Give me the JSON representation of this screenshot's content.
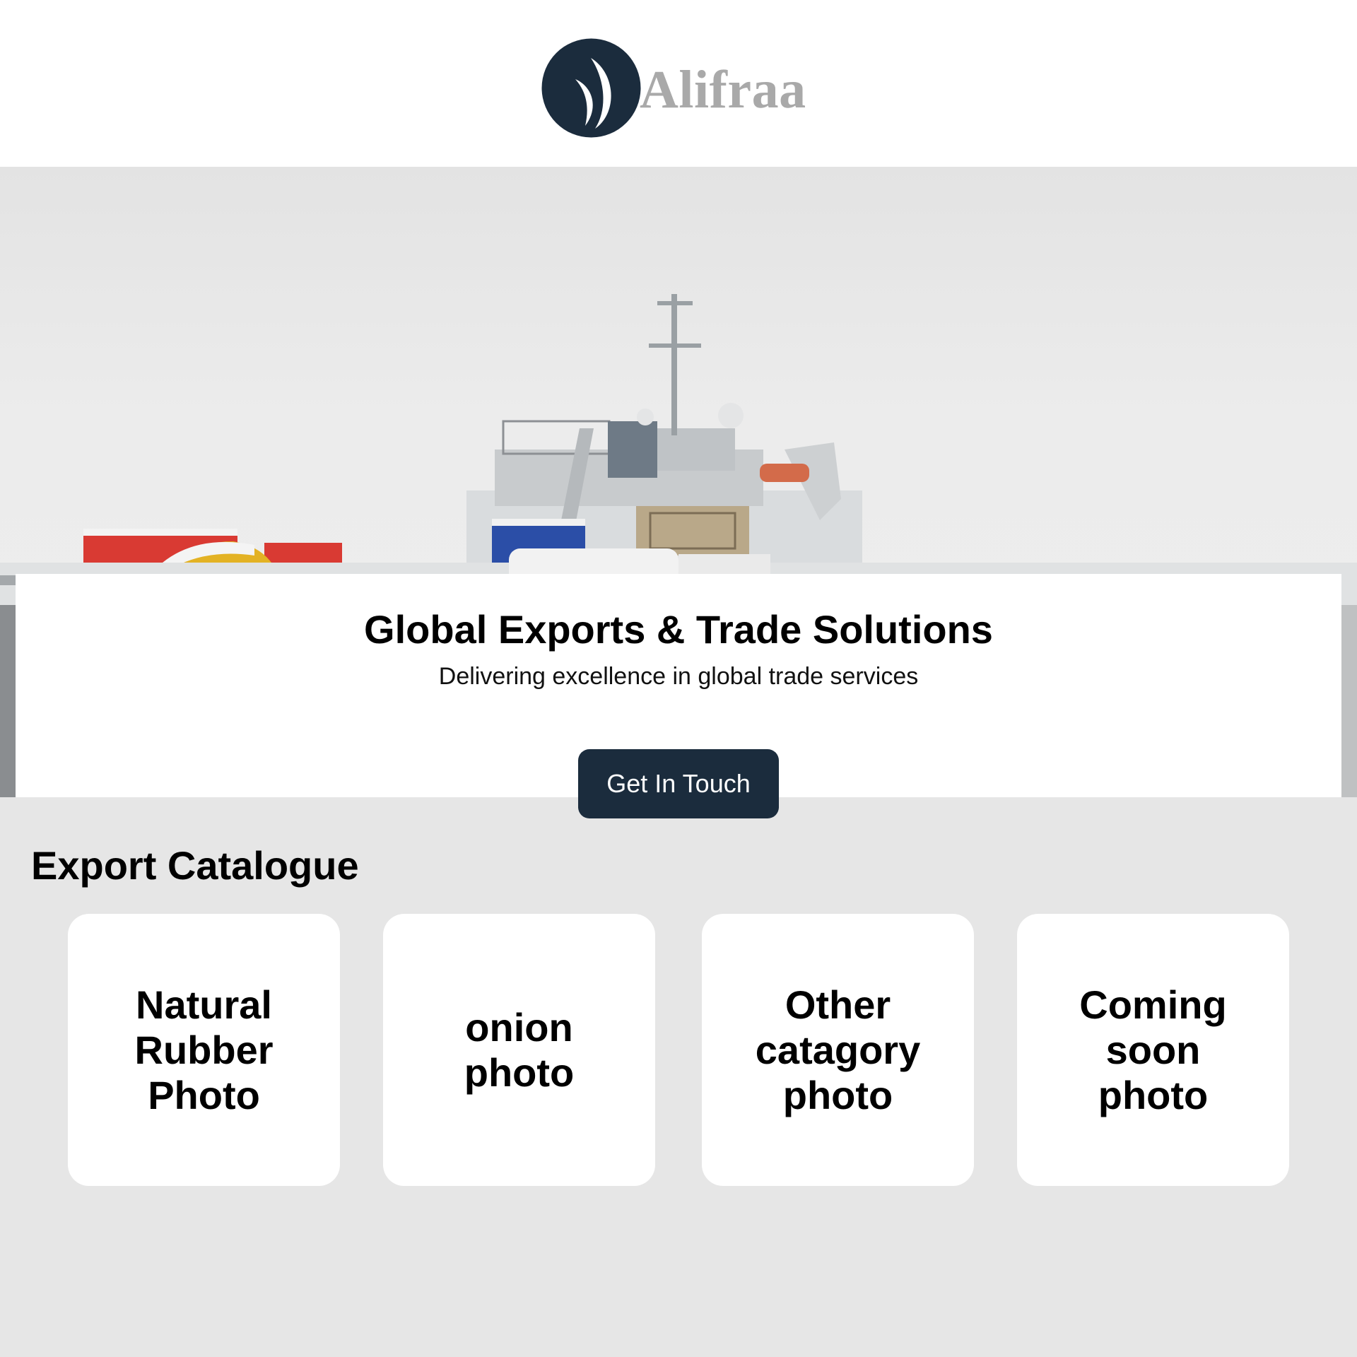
{
  "brand": {
    "name": "Alifraa",
    "logo_icon": "sail-moon-logo-icon",
    "mark_color": "#1b2c3d",
    "text_color": "#a9a9a9"
  },
  "hero": {
    "image": "cargo-ship-in-snow-photo",
    "title": "Global Exports & Trade Solutions",
    "subtitle": "Delivering excellence in global trade services",
    "cta_label": "Get In Touch",
    "cta_color": "#1b2c3d"
  },
  "catalogue": {
    "title": "Export Catalogue",
    "items": [
      {
        "label": "Natural\nRubber\nPhoto"
      },
      {
        "label": "onion\nphoto"
      },
      {
        "label": "Other\ncatagory\nphoto"
      },
      {
        "label": "Coming\nsoon\nphoto"
      }
    ]
  },
  "colors": {
    "page_background": "#e6e6e6",
    "card_background": "#ffffff"
  }
}
